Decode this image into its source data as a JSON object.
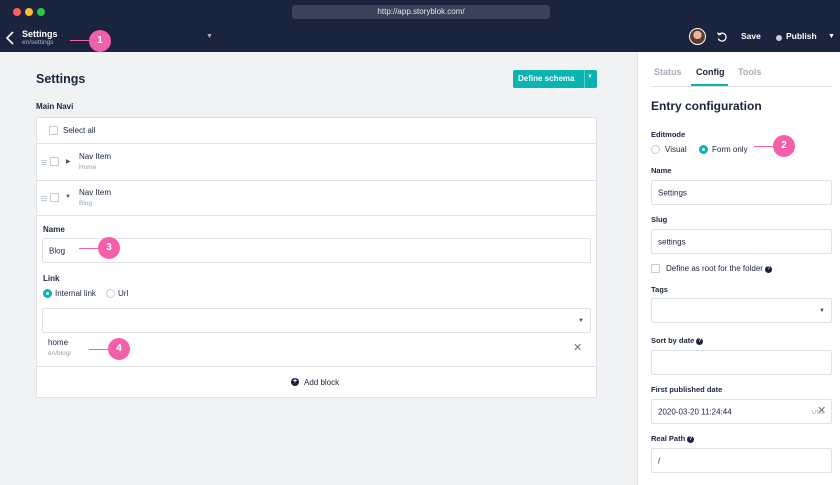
{
  "browser": {
    "url": "http://app.storyblok.com/"
  },
  "header": {
    "title": "Settings",
    "subtitle": "en/settings",
    "save_label": "Save",
    "publish_label": "Publish"
  },
  "main": {
    "title": "Settings",
    "define_schema_label": "Define schema",
    "section_label": "Main Navi",
    "select_all_label": "Select all",
    "items": [
      {
        "title": "Nav Item",
        "subtitle": "Home"
      },
      {
        "title": "Nav Item",
        "subtitle": "Blog"
      }
    ],
    "name_label": "Name",
    "name_value": "Blog",
    "link_label": "Link",
    "link_options": [
      "Internal link",
      "Url"
    ],
    "link_selected": "Internal link",
    "linked_story": {
      "title": "home",
      "path": "en/blog/"
    },
    "add_block_label": "Add block"
  },
  "sidebar": {
    "tabs": [
      "Status",
      "Config",
      "Tools"
    ],
    "active_tab": "Config",
    "title": "Entry configuration",
    "editmode_label": "Editmode",
    "editmode_options": [
      "Visual",
      "Form only"
    ],
    "editmode_selected": "Form only",
    "name_label": "Name",
    "name_value": "Settings",
    "slug_label": "Slug",
    "slug_value": "settings",
    "root_folder_label": "Define as root for the folder",
    "tags_label": "Tags",
    "sort_by_date_label": "Sort by date",
    "first_published_label": "First published date",
    "first_published_value": "2020-03-20 11:24:44",
    "timezone_label": "UTC",
    "real_path_label": "Real Path",
    "real_path_value": "/"
  },
  "annotations": [
    "1",
    "2",
    "3",
    "4"
  ],
  "colors": {
    "accent": "#09b3af",
    "header": "#1b243f",
    "marker": "#f35fa8"
  }
}
